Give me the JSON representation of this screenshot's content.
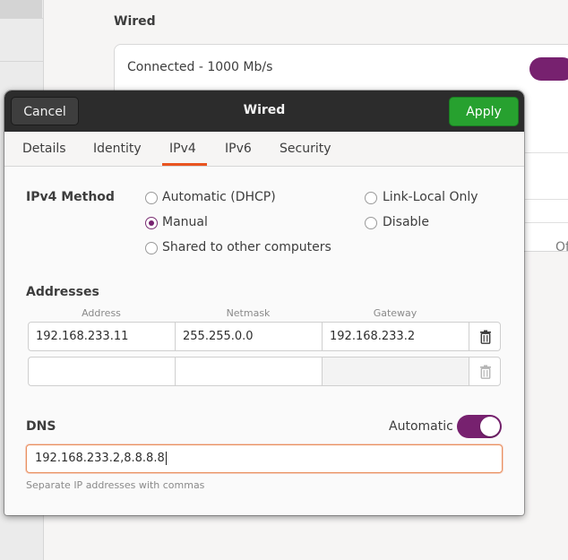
{
  "background": {
    "section_title": "Wired",
    "connection_status": "Connected - 1000 Mb/s",
    "partial_text": "Of"
  },
  "dialog": {
    "title": "Wired",
    "cancel_label": "Cancel",
    "apply_label": "Apply",
    "tabs": [
      {
        "label": "Details"
      },
      {
        "label": "Identity"
      },
      {
        "label": "IPv4"
      },
      {
        "label": "IPv6"
      },
      {
        "label": "Security"
      }
    ],
    "active_tab": "IPv4"
  },
  "ipv4": {
    "method_label": "IPv4 Method",
    "methods": [
      {
        "label": "Automatic (DHCP)",
        "checked": false
      },
      {
        "label": "Link-Local Only",
        "checked": false
      },
      {
        "label": "Manual",
        "checked": true
      },
      {
        "label": "Disable",
        "checked": false
      },
      {
        "label": "Shared to other computers",
        "checked": false
      }
    ]
  },
  "addresses": {
    "section_label": "Addresses",
    "columns": [
      "Address",
      "Netmask",
      "Gateway"
    ],
    "rows": [
      {
        "address": "192.168.233.11",
        "netmask": "255.255.0.0",
        "gateway": "192.168.233.2"
      },
      {
        "address": "",
        "netmask": "",
        "gateway": ""
      }
    ]
  },
  "dns": {
    "label": "DNS",
    "automatic_label": "Automatic",
    "automatic_on": true,
    "value": "192.168.233.2,8.8.8.8",
    "hint": "Separate IP addresses with commas"
  },
  "colors": {
    "accent_orange": "#e95420",
    "toggle_purple": "#77216f",
    "apply_green": "#27a12f"
  }
}
